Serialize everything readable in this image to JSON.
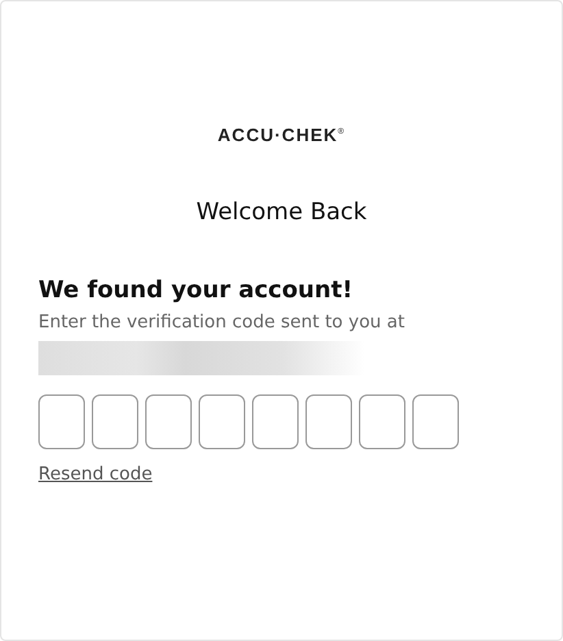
{
  "logo": {
    "text": "ACCU·CHEK$^{®}$"
  },
  "title": "Welcome Back",
  "heading": "We found your account!",
  "subtitle": "Enter the verification code sent to you at",
  "code_fields": [
    {
      "kind": "digit"
    },
    {
      "kind": "digit"
    },
    {
      "kind": "digit"
    },
    {
      "kind": "digit"
    },
    {
      "kind": "digit"
    },
    {
      "kind": "digit"
    },
    {
      "kind": "digit"
    },
    {
      "kind": "digit"
    }
  ],
  "resend_link": "Resend code"
}
